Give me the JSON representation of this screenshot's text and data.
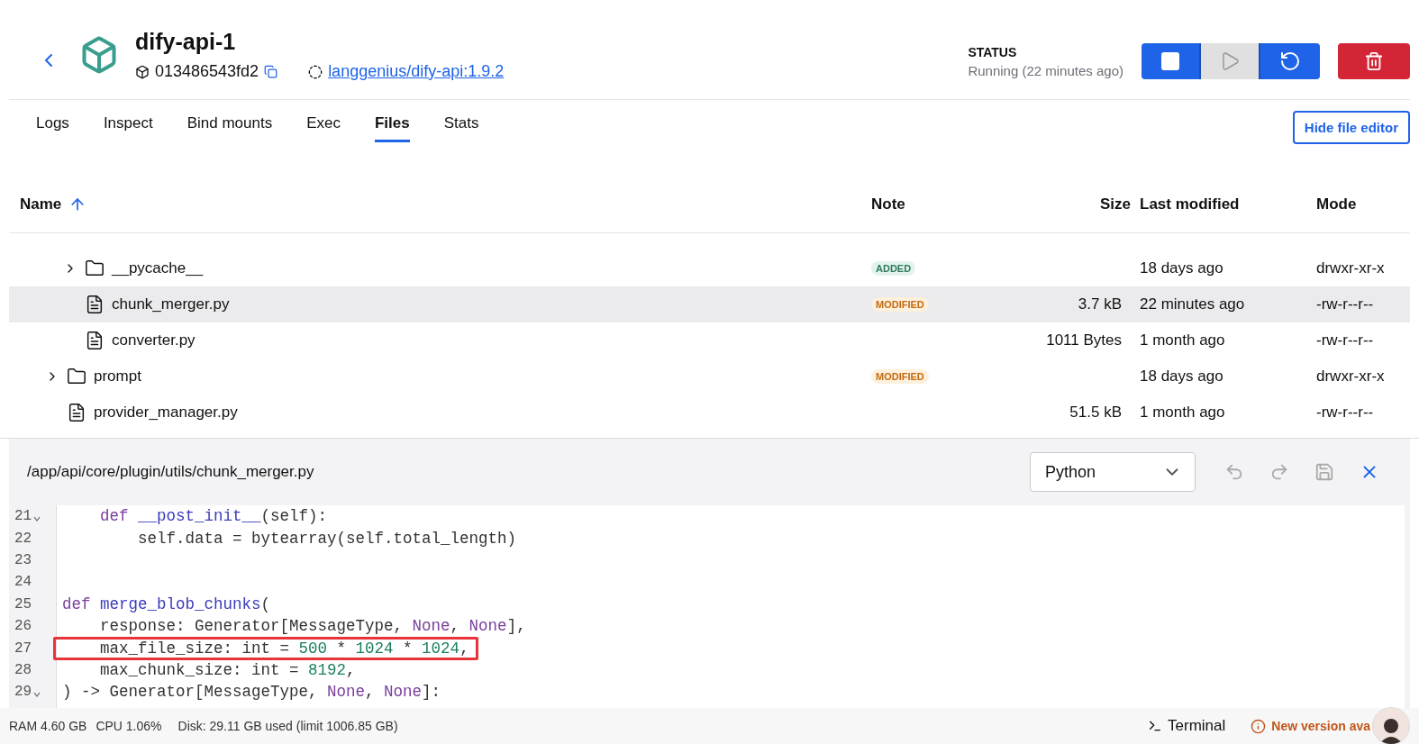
{
  "container": {
    "name": "dify-api-1",
    "id": "013486543fd2",
    "image": "langgenius/dify-api:1.9.2"
  },
  "status": {
    "label": "STATUS",
    "value": "Running (22 minutes ago)"
  },
  "actions": [
    {
      "kind": "stop",
      "disabled": false
    },
    {
      "kind": "start",
      "disabled": true
    },
    {
      "kind": "restart",
      "disabled": false
    },
    {
      "kind": "delete",
      "disabled": false
    }
  ],
  "tabs": [
    {
      "label": "Logs",
      "selected": false
    },
    {
      "label": "Inspect",
      "selected": false
    },
    {
      "label": "Bind mounts",
      "selected": false
    },
    {
      "label": "Exec",
      "selected": false
    },
    {
      "label": "Files",
      "selected": true
    },
    {
      "label": "Stats",
      "selected": false
    }
  ],
  "hide_editor_button": "Hide file editor",
  "table": {
    "columns": [
      {
        "label": "Name",
        "sorted": true
      },
      {
        "label": "Note"
      },
      {
        "label": "Size"
      },
      {
        "label": "Last modified"
      },
      {
        "label": "Mode"
      }
    ],
    "rows": [
      {
        "children": [
          {
            "kind": "folder",
            "name": "__pycache__",
            "expanded": false,
            "selected": false,
            "note": {
              "kind": "added",
              "label": "ADDED"
            },
            "modified": "18 days ago",
            "mode": "drwxr-xr-x"
          },
          {
            "kind": "file",
            "name": "chunk_merger.py",
            "selected": true,
            "note": {
              "kind": "modified",
              "label": "MODIFIED"
            },
            "size": "3.7 kB",
            "modified": "22 minutes ago",
            "mode": "-rw-r--r--"
          },
          {
            "kind": "file",
            "name": "converter.py",
            "selected": false,
            "size": "1011 Bytes",
            "modified": "1 month ago",
            "mode": "-rw-r--r--"
          }
        ]
      },
      {
        "kind": "folder",
        "name": "prompt",
        "expanded": false,
        "selected": false,
        "note": {
          "kind": "modified",
          "label": "MODIFIED"
        },
        "modified": "18 days ago",
        "mode": "drwxr-xr-x"
      },
      {
        "kind": "file",
        "name": "provider_manager.py",
        "selected": false,
        "size": "51.5 kB",
        "modified": "1 month ago",
        "mode": "-rw-r--r--"
      }
    ]
  },
  "editor": {
    "path": "/app/api/core/plugin/utils/chunk_merger.py",
    "language": "Python",
    "lines": [
      {
        "number": "21",
        "foldable": true,
        "tokens": [
          {
            "kind": "keyword",
            "text": "    def "
          },
          {
            "kind": "function",
            "text": "__post_init__"
          },
          {
            "kind": "plain",
            "text": "(self):"
          }
        ]
      },
      {
        "number": "22",
        "tokens": [
          {
            "kind": "plain",
            "text": "        self.data = bytearray(self.total_length)"
          }
        ]
      },
      {
        "number": "23"
      },
      {
        "number": "24"
      },
      {
        "number": "25",
        "tokens": [
          {
            "kind": "keyword",
            "text": "def "
          },
          {
            "kind": "function",
            "text": "merge_blob_chunks"
          },
          {
            "kind": "plain",
            "text": "("
          }
        ]
      },
      {
        "number": "26",
        "tokens": [
          {
            "kind": "plain",
            "text": "    response: Generator[MessageType, "
          },
          {
            "kind": "constant",
            "text": "None"
          },
          {
            "kind": "plain",
            "text": ", "
          },
          {
            "kind": "constant",
            "text": "None"
          },
          {
            "kind": "plain",
            "text": "],"
          }
        ]
      },
      {
        "number": "27",
        "highlighted": true,
        "tokens": [
          {
            "kind": "plain",
            "text": "    max_file_size: int = "
          },
          {
            "kind": "number",
            "text": "500"
          },
          {
            "kind": "plain",
            "text": " * "
          },
          {
            "kind": "number",
            "text": "1024"
          },
          {
            "kind": "plain",
            "text": " * "
          },
          {
            "kind": "number",
            "text": "1024"
          },
          {
            "kind": "plain",
            "text": ","
          }
        ]
      },
      {
        "number": "28",
        "tokens": [
          {
            "kind": "plain",
            "text": "    max_chunk_size: int = "
          },
          {
            "kind": "number",
            "text": "8192"
          },
          {
            "kind": "plain",
            "text": ","
          }
        ]
      },
      {
        "number": "29",
        "foldable": true,
        "tokens": [
          {
            "kind": "plain",
            "text": ") -> Generator[MessageType, "
          },
          {
            "kind": "constant",
            "text": "None"
          },
          {
            "kind": "plain",
            "text": ", "
          },
          {
            "kind": "constant",
            "text": "None"
          },
          {
            "kind": "plain",
            "text": "]:"
          }
        ]
      }
    ]
  },
  "status_bar": {
    "stats": [
      "RAM 4.60 GB",
      "CPU 1.06%",
      "Disk: 29.11 GB used (limit 1006.85 GB)"
    ],
    "terminal": "Terminal",
    "update": "New version ava"
  }
}
